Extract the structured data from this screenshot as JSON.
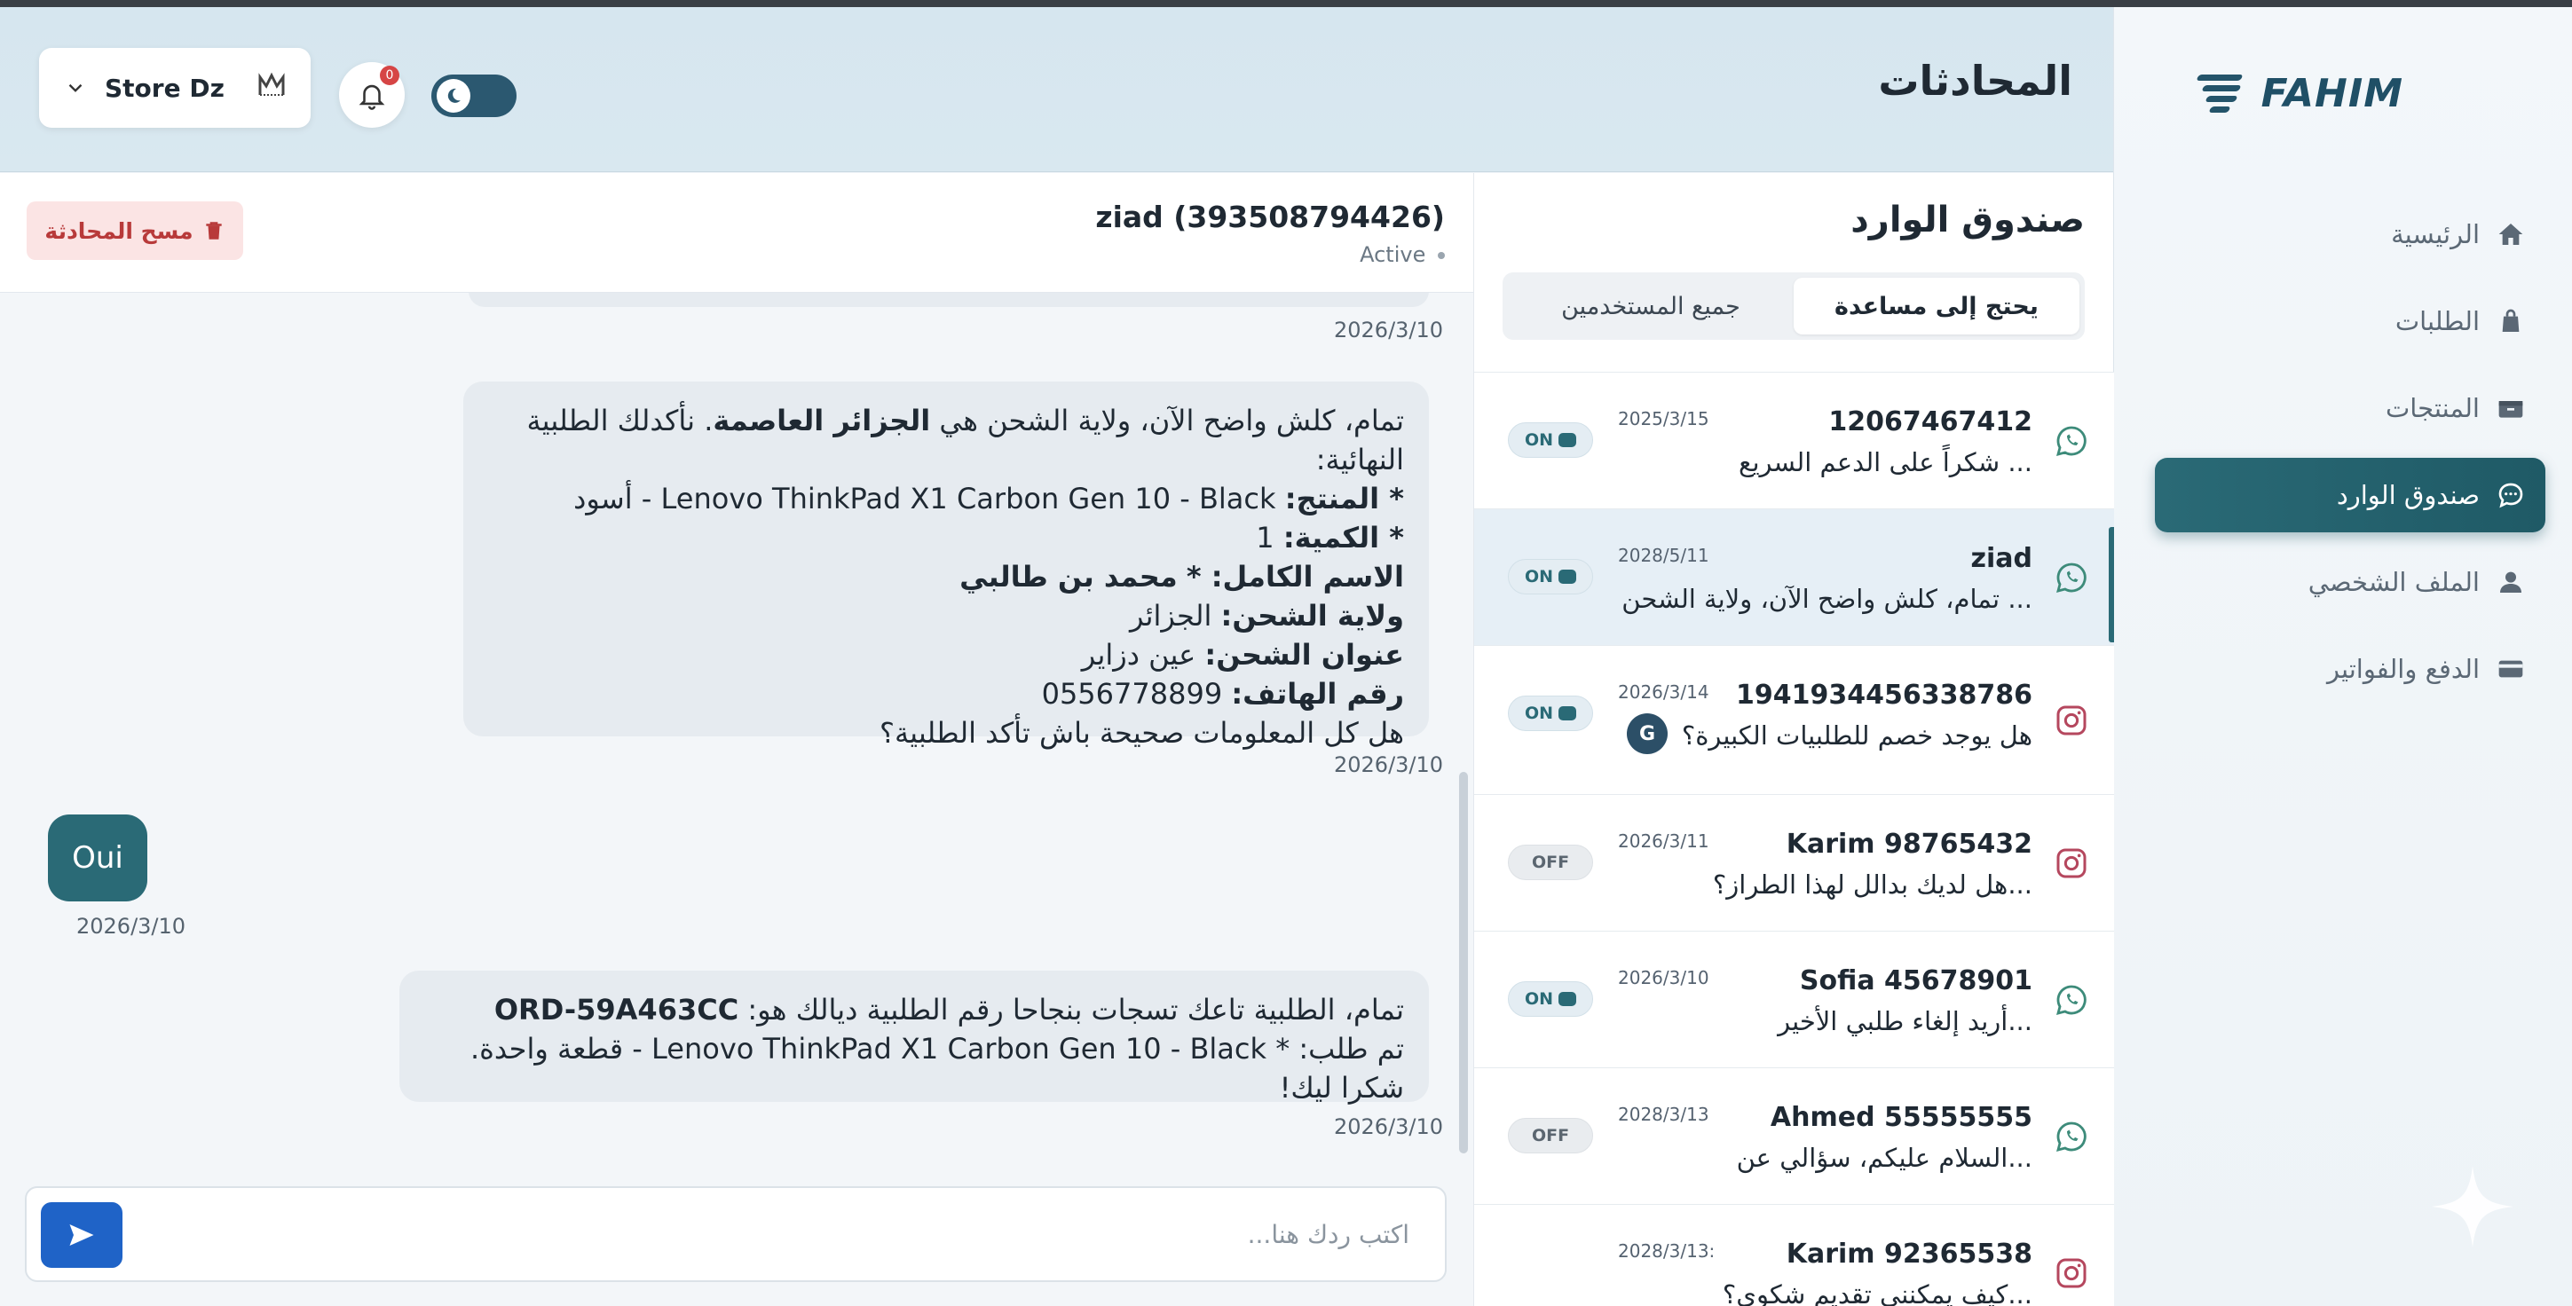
{
  "brand": {
    "logo_text": "FAHIM"
  },
  "sidebar": {
    "items": [
      {
        "label": "الرئيسية",
        "icon": "home-icon",
        "active": false
      },
      {
        "label": "الطلبات",
        "icon": "bag-icon",
        "active": false
      },
      {
        "label": "المنتجات",
        "icon": "box-icon",
        "active": false
      },
      {
        "label": "صندوق الوارد",
        "icon": "chat-icon",
        "active": true
      },
      {
        "label": "الملف الشخصي",
        "icon": "user-icon",
        "active": false
      },
      {
        "label": "الدفع والفواتير",
        "icon": "card-icon",
        "active": false
      }
    ]
  },
  "header": {
    "title": "المحادثات",
    "store": {
      "name": "Store Dz"
    },
    "notifications": {
      "count": "0"
    }
  },
  "inbox": {
    "title": "صندوق الوارد",
    "tabs": [
      {
        "label": "يحتج إلى مساعدة",
        "active": true
      },
      {
        "label": "جميع المستخدمين",
        "active": false
      }
    ],
    "conversations": [
      {
        "name": "12067467412",
        "message": "شكراً على الدعم السريع ...",
        "date": "2025/3/15",
        "status": "ON",
        "channel": "whatsapp-icon"
      },
      {
        "name": "ziad",
        "message": "تمام، كلش واضح الآن، ولاية الشحن ...",
        "date": "2028/5/11",
        "status": "ON",
        "channel": "whatsapp-icon",
        "selected": true
      },
      {
        "name": "1941934456338786",
        "message": "هل يوجد خصم للطلبيات الكبيرة؟",
        "date": "2026/3/14",
        "status": "ON",
        "channel": "instagram-icon",
        "avatar": "G"
      },
      {
        "name": "Karim 98765432",
        "message": "هل لديك بدالل لهذا الطراز؟...",
        "date": "2026/3/11",
        "status": "OFF",
        "channel": "instagram-icon"
      },
      {
        "name": "Sofia 45678901",
        "message": "أريد إلغاء طلبي الأخير...",
        "date": "2026/3/10",
        "status": "ON",
        "channel": "whatsapp-icon"
      },
      {
        "name": "Ahmed 55555555",
        "message": "السلام عليكم، سؤالي عن...",
        "date": "2028/3/13",
        "status": "OFF",
        "channel": "whatsapp-icon"
      },
      {
        "name": "Karim 92365538",
        "message": "كيف يمكنني تقديم شكوى؟...",
        "date": "2028/3/13:",
        "status": "",
        "channel": "instagram-icon"
      }
    ]
  },
  "chat": {
    "contact_name": "ziad (393508794426)",
    "contact_status": "Active",
    "clear_label": "مسح المحادثة",
    "time_top": "2026/3/10",
    "message1": {
      "line1_prefix": "تمام، كلش واضح الآن، ولاية الشحن هي",
      "line1_bold": "الجزائر العاصمة",
      "line1_suffix": ". نأكدلك الطلبية النهائية:",
      "product_label": "* المنتج:",
      "product_value": "Lenovo ThinkPad X1 Carbon Gen 10 - Black - أسود",
      "qty_label": "* الكمية:",
      "qty_value": "1",
      "fullname_label": "الاسم الكامل: *",
      "fullname_value": "محمد بن طالبي",
      "state_label": "ولاية الشحن:",
      "state_value": "الجزائر",
      "address_label": "عنوان الشحن:",
      "address_value": "عين دزاير",
      "phone_label": "رقم الهاتف:",
      "phone_value": "0556778899",
      "question": "هل كل المعلومات صحيحة باش تأكد الطلبية؟"
    },
    "time1": "2026/3/10",
    "reply": "Oui",
    "time_reply": "2026/3/10",
    "message2": {
      "line1_prefix": "تمام، الطلبية تاعك تسجات بنجاحا رقم الطلبية ديالك هو:",
      "order_id": "ORD-59A463CC",
      "line2": "تم طلب: * Lenovo ThinkPad X1 Carbon Gen 10 - Black - قطعة واحدة. شكرا ليك!"
    },
    "time2": "2026/3/10",
    "composer_placeholder": "اكتب ردك هنا..."
  },
  "colors": {
    "accent": "#2a6a76",
    "send": "#1f63c7",
    "danger_bg": "#fbe4e4",
    "danger_text": "#b83a3a"
  }
}
